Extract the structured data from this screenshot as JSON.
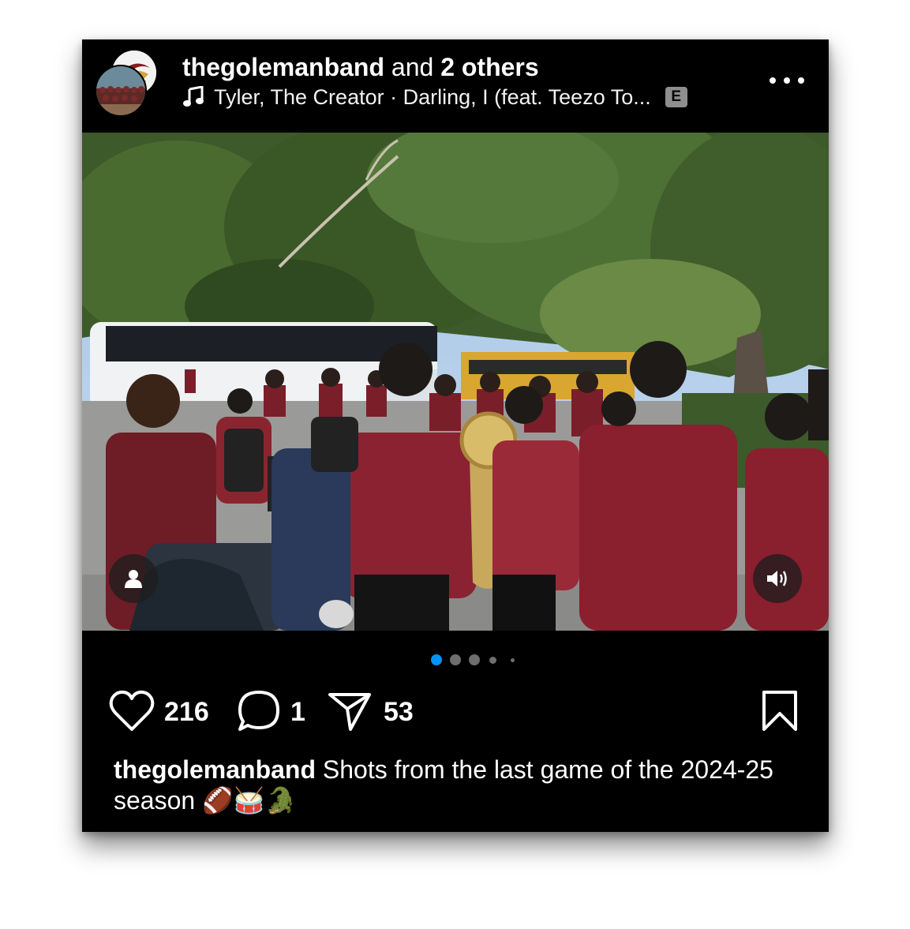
{
  "post": {
    "username": "thegolemanband",
    "and_text": " and ",
    "others": "2 others",
    "music": "Tyler, The Creator · Darling, I (feat. Teezo To...",
    "explicit_badge": "E",
    "caption_user": "thegolemanband",
    "caption_text": " Shots from the last game of the 2024-25 season 🏈🥁🐊"
  },
  "carousel": {
    "total_dots": 5,
    "active_index": 0,
    "active_color": "#0095f6"
  },
  "actions": {
    "likes": "216",
    "comments": "1",
    "shares": "53"
  },
  "icons": {
    "more": "more-options-icon",
    "music": "music-note-icon",
    "like": "heart-icon",
    "comment": "comment-icon",
    "share": "send-icon",
    "save": "bookmark-icon",
    "tag": "person-icon",
    "audio": "speaker-icon"
  }
}
